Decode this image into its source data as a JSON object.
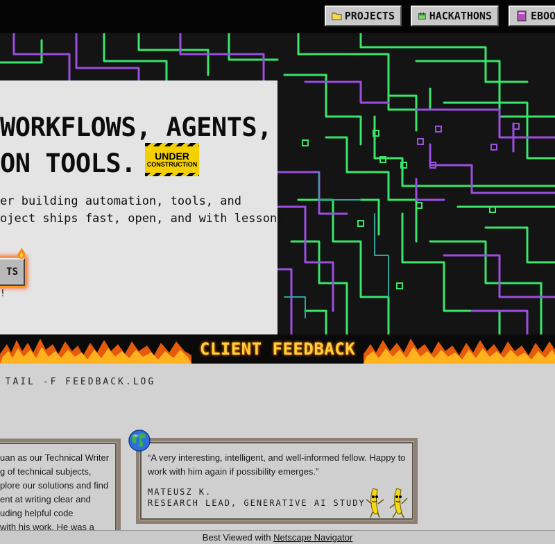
{
  "nav": {
    "projects_label": "PROJECTS",
    "hackathons_label": "HACKATHONS",
    "ebooks_label": "EBOO"
  },
  "hero": {
    "headline_line1": "WORKFLOWS, AGENTS,",
    "headline_line2": "ON TOOLS.",
    "badge_line1": "UNDER",
    "badge_line2": "CONSTRUCTION",
    "sub_line1": "er building automation, tools, and",
    "sub_line2": "oject ships fast, open, and with lessons",
    "cta_label": "TS",
    "cta_note": "!"
  },
  "feedback": {
    "banner_title": "CLIENT FEEDBACK",
    "terminal_command": "$ TAIL -F FEEDBACK.LOG",
    "card1": {
      "quote_line1": "uan as our Technical Writer",
      "quote_line2": "g of technical subjects,",
      "quote_line3": "plore our solutions and find",
      "quote_line4": "ent at writing clear and",
      "quote_line5": "uding helpful code",
      "quote_line6": "with his work. He was a"
    },
    "card2": {
      "quote_line1": "“A very interesting, intelligent, and well-informed fellow. Happy to",
      "quote_line2": "work with him again if possibility emerges.”",
      "author_name": "MATEUSZ K.",
      "author_role": "RESEARCH LEAD, GENERATIVE AI STUDY"
    }
  },
  "footer": {
    "prefix": "Best Viewed with",
    "link_text": "Netscape Navigator"
  },
  "icons": {
    "projects": "folder-icon",
    "hackathons": "calendar-icon",
    "ebooks": "book-icon",
    "globe": "globe-icon",
    "mascot": "dancing-banana-icon"
  },
  "colors": {
    "circuit_green": "#39e66b",
    "circuit_purple": "#9b4fe0",
    "banner_text": "#ffd23a",
    "badge_yellow": "#f4d000"
  }
}
